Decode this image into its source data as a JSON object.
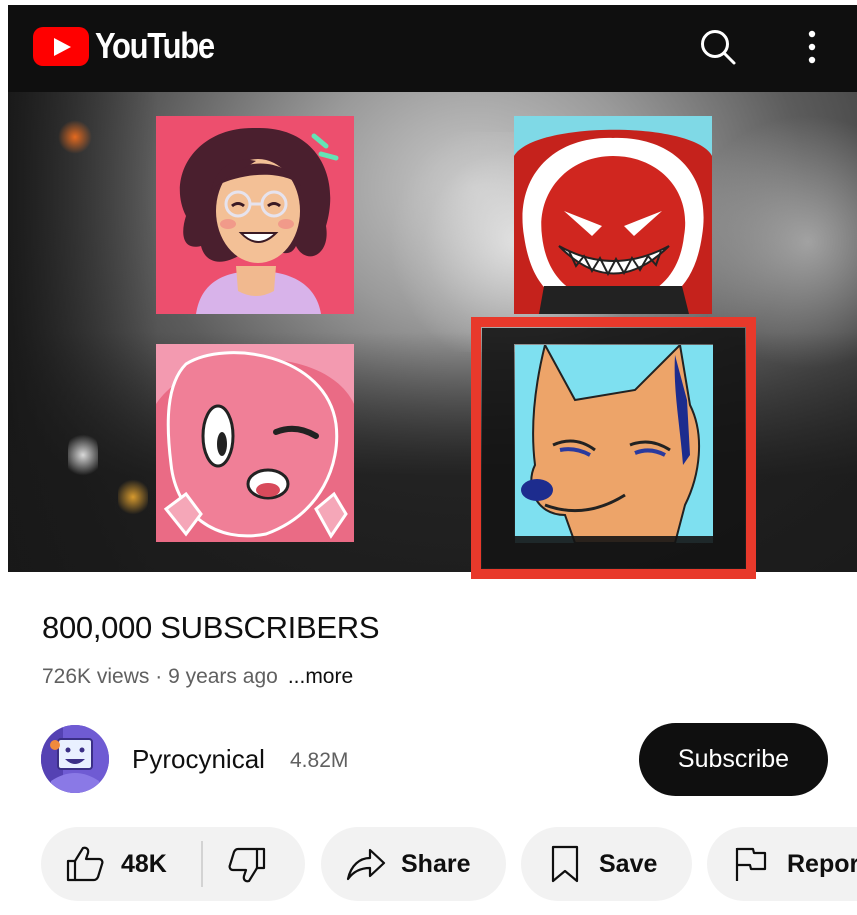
{
  "app": {
    "name": "YouTube",
    "brand_color": "#ff0000",
    "header_bg": "#0f0f0f"
  },
  "header": {
    "logo_text": "YouTube",
    "icons": [
      "search-icon",
      "more-vert-icon"
    ]
  },
  "video": {
    "title": "800,000 SUBSCRIBERS",
    "views": "726K views",
    "separator": " · ",
    "age": "9 years ago",
    "more_label": "...more",
    "highlight_color": "#e8392b"
  },
  "channel": {
    "name": "Pyrocynical",
    "subscribers": "4.82M",
    "subscribe_label": "Subscribe"
  },
  "actions": {
    "likes": "48K",
    "share_label": "Share",
    "save_label": "Save",
    "report_label": "Report"
  }
}
